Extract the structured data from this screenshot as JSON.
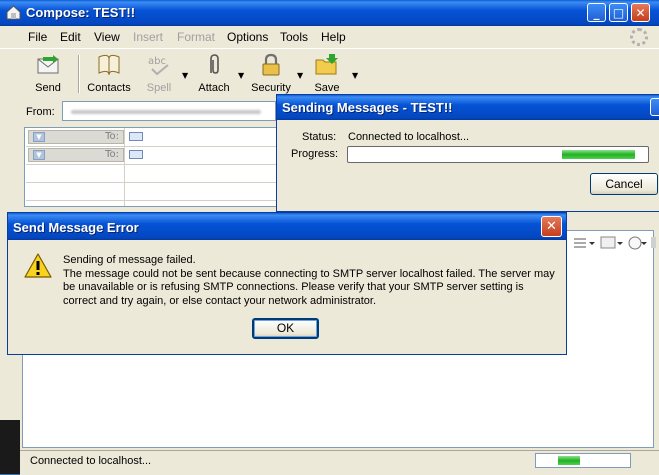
{
  "compose": {
    "title": "Compose: TEST!!",
    "window_buttons": {
      "minimize": "_",
      "maximize": "□",
      "close": "✕"
    },
    "menu": [
      "File",
      "Edit",
      "View",
      "Insert",
      "Format",
      "Options",
      "Tools",
      "Help"
    ],
    "menu_disabled": [
      "Insert",
      "Format"
    ],
    "toolbar": {
      "send": "Send",
      "contacts": "Contacts",
      "spell": "Spell",
      "attach": "Attach",
      "security": "Security",
      "save": "Save"
    },
    "from_label": "From:",
    "address_rows": [
      {
        "type": "To:"
      },
      {
        "type": "To:"
      }
    ],
    "status_text": "Connected to localhost...",
    "status_progress": 0.23
  },
  "sending_dialog": {
    "title": "Sending Messages - TEST!!",
    "status_label": "Status:",
    "status_value": "Connected to localhost...",
    "progress_label": "Progress:",
    "progress_fraction": 0.25,
    "cancel_label": "Cancel"
  },
  "error_dialog": {
    "title": "Send Message Error",
    "close_glyph": "✕",
    "message_lines": [
      "Sending of message failed.",
      "The message could not be sent because connecting to SMTP server localhost failed. The server may",
      "be unavailable or is refusing SMTP connections. Please verify that your SMTP server setting is",
      "correct and try again, or else contact your network administrator."
    ],
    "ok_label": "OK"
  },
  "colors": {
    "xp_title_blue": "#0553d6",
    "progress_green": "#1fb31f",
    "dialog_face": "#ece9d8"
  }
}
